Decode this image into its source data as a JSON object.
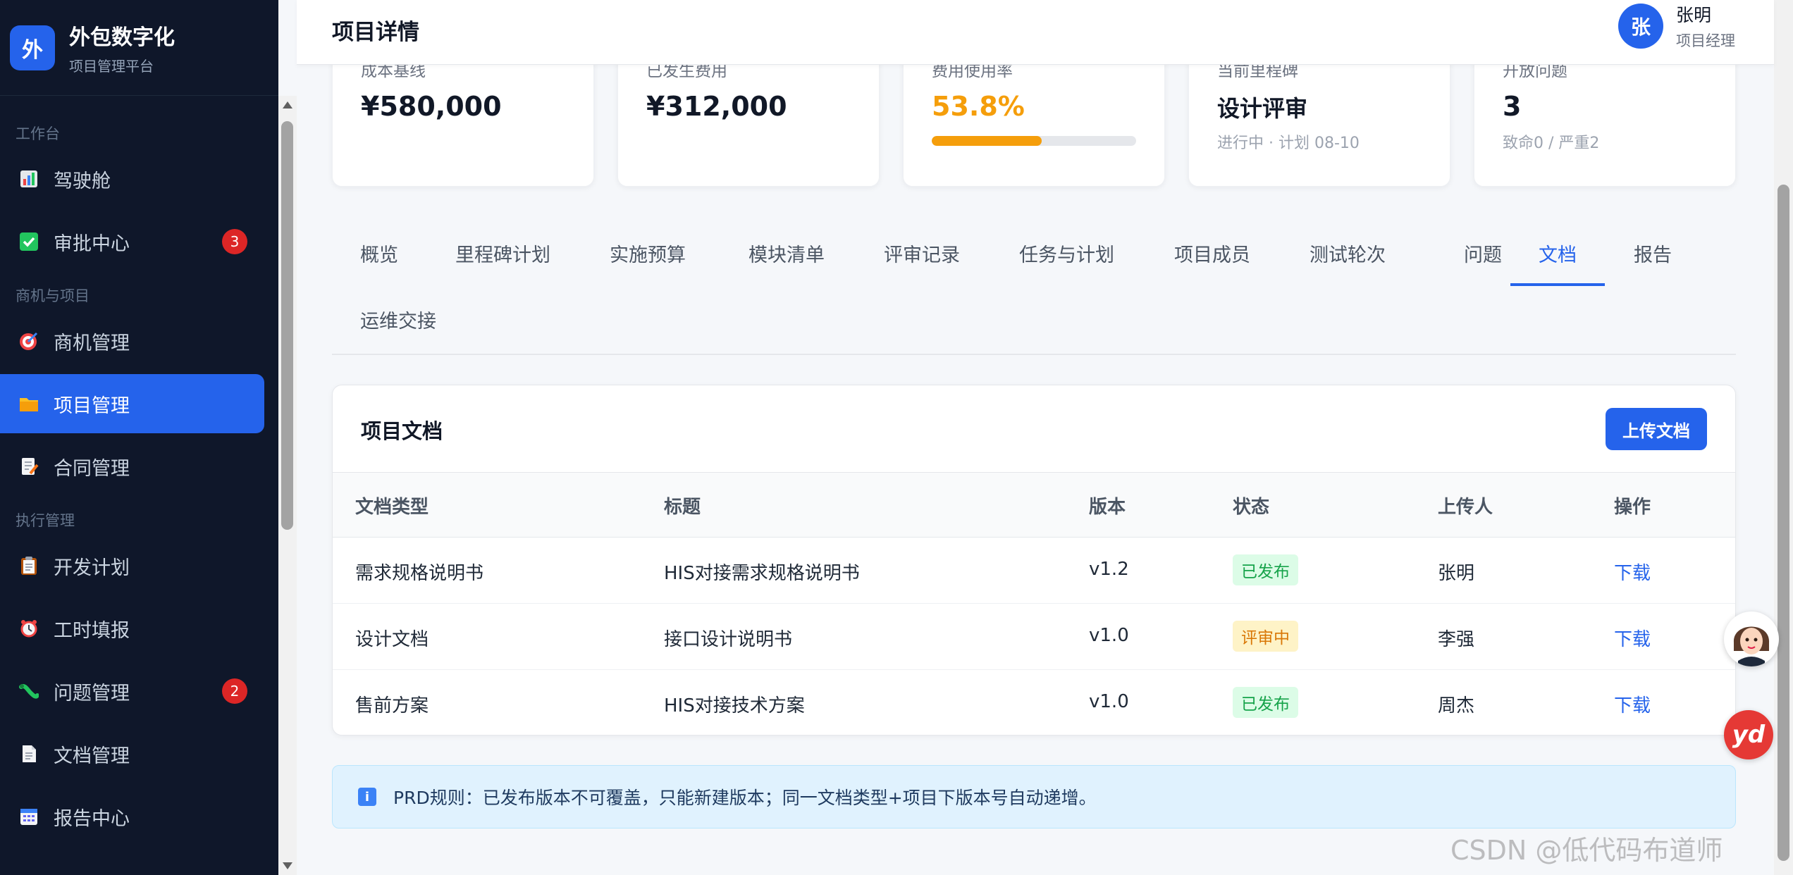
{
  "brand": {
    "logo": "外",
    "title": "外包数字化",
    "subtitle": "项目管理平台"
  },
  "sidebar": {
    "groups": [
      {
        "label": "工作台",
        "items": [
          {
            "label": "驾驶舱",
            "icon": "chart-icon"
          },
          {
            "label": "审批中心",
            "icon": "check-icon",
            "badge": "3"
          }
        ]
      },
      {
        "label": "商机与项目",
        "items": [
          {
            "label": "商机管理",
            "icon": "target-icon"
          },
          {
            "label": "项目管理",
            "icon": "folder-icon",
            "active": true
          },
          {
            "label": "合同管理",
            "icon": "contract-icon"
          }
        ]
      },
      {
        "label": "执行管理",
        "items": [
          {
            "label": "开发计划",
            "icon": "clipboard-icon"
          },
          {
            "label": "工时填报",
            "icon": "alarm-icon"
          },
          {
            "label": "问题管理",
            "icon": "bug-icon",
            "badge": "2"
          },
          {
            "label": "文档管理",
            "icon": "document-icon"
          },
          {
            "label": "报告中心",
            "icon": "calendar-icon"
          }
        ]
      }
    ]
  },
  "header": {
    "title": "项目详情",
    "user": {
      "avatar": "张",
      "name": "张明",
      "role": "项目经理"
    }
  },
  "stats": [
    {
      "label": "成本基线",
      "value": "¥580,000"
    },
    {
      "label": "已发生费用",
      "value": "¥312,000"
    },
    {
      "label": "费用使用率",
      "value": "53.8%",
      "progress": 0.538
    },
    {
      "label": "当前里程碑",
      "value": "设计评审",
      "sub": "进行中 · 计划 08-10"
    },
    {
      "label": "开放问题",
      "value": "3",
      "sub": "致命0 / 严重2"
    }
  ],
  "tabs": [
    "概览",
    "里程碑计划",
    "实施预算",
    "模块清单",
    "评审记录",
    "任务与计划",
    "项目成员",
    "测试轮次",
    "问题",
    "文档",
    "报告",
    "运维交接"
  ],
  "active_tab": "文档",
  "documents": {
    "title": "项目文档",
    "upload_label": "上传文档",
    "columns": [
      "文档类型",
      "标题",
      "版本",
      "状态",
      "上传人",
      "操作"
    ],
    "rows": [
      {
        "type": "需求规格说明书",
        "title": "HIS对接需求规格说明书",
        "version": "v1.2",
        "status": "已发布",
        "status_color": "#16a34a",
        "uploader": "张明",
        "action": "下载"
      },
      {
        "type": "设计文档",
        "title": "接口设计说明书",
        "version": "v1.0",
        "status": "评审中",
        "status_color": "#d97706",
        "uploader": "李强",
        "action": "下载"
      },
      {
        "type": "售前方案",
        "title": "HIS对接技术方案",
        "version": "v1.0",
        "status": "已发布",
        "status_color": "#16a34a",
        "uploader": "周杰",
        "action": "下载"
      }
    ]
  },
  "info": {
    "icon": "i",
    "text": "PRD规则：已发布版本不可覆盖，只能新建版本；同一文档类型+项目下版本号自动递增。"
  },
  "floating": {
    "yd_label": "yd"
  },
  "watermark": "CSDN @低代码布道师",
  "colors": {
    "primary": "#2563eb",
    "sidebar_bg": "#0f172a",
    "warning": "#f59e0b",
    "danger": "#dc2626"
  }
}
